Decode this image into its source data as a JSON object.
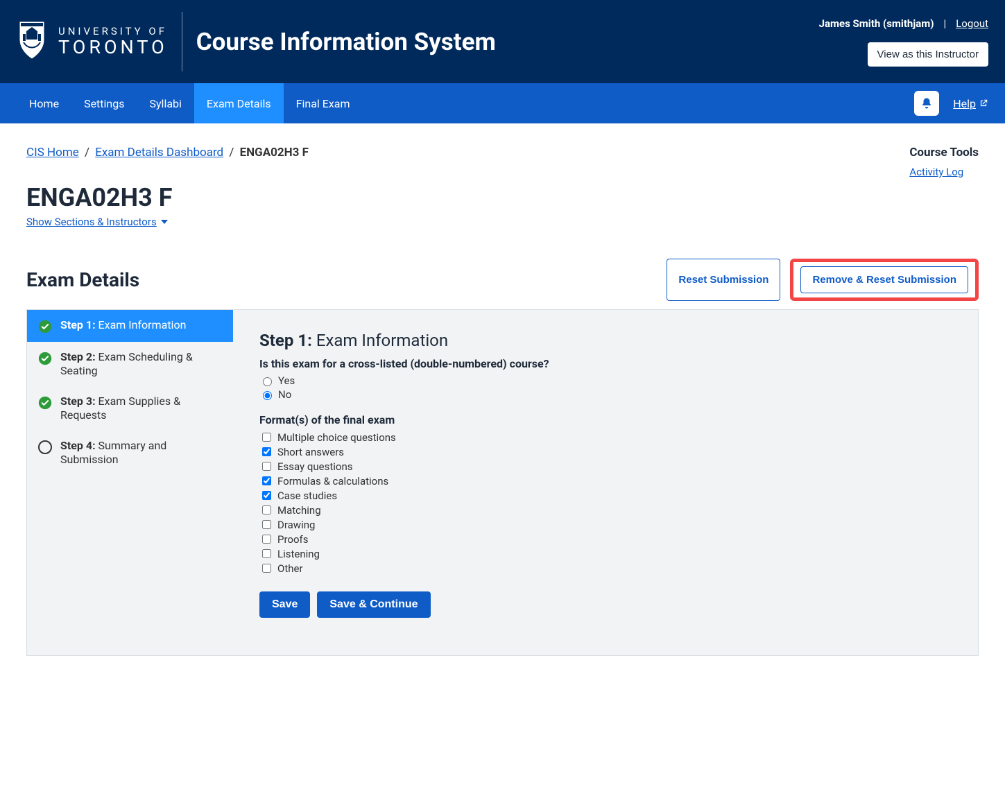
{
  "header": {
    "brand_line1": "UNIVERSITY OF",
    "brand_line2": "TORONTO",
    "app_title": "Course Information System",
    "user_display": "James Smith (smithjam)",
    "logout": "Logout",
    "view_as": "View as this Instructor"
  },
  "nav": {
    "items": [
      "Home",
      "Settings",
      "Syllabi",
      "Exam Details",
      "Final Exam"
    ],
    "active_index": 3,
    "help": "Help"
  },
  "breadcrumb": {
    "home": "CIS Home",
    "dash": "Exam Details Dashboard",
    "current": "ENGA02H3 F"
  },
  "course_tools": {
    "title": "Course Tools",
    "activity_log": "Activity Log"
  },
  "page": {
    "title": "ENGA02H3 F",
    "show_sections": "Show Sections & Instructors"
  },
  "exam_details": {
    "heading": "Exam Details",
    "reset": "Reset Submission",
    "remove_reset": "Remove & Reset Submission"
  },
  "steps": [
    {
      "prefix": "Step 1:",
      "label": "Exam Information",
      "complete": true,
      "active": true
    },
    {
      "prefix": "Step 2:",
      "label": "Exam Scheduling & Seating",
      "complete": true,
      "active": false
    },
    {
      "prefix": "Step 3:",
      "label": "Exam Supplies & Requests",
      "complete": true,
      "active": false
    },
    {
      "prefix": "Step 4:",
      "label": "Summary and Submission",
      "complete": false,
      "active": false
    }
  ],
  "step1": {
    "heading_prefix": "Step 1:",
    "heading_text": "Exam Information",
    "q1_label": "Is this exam for a cross-listed (double-numbered) course?",
    "q1_options": [
      {
        "label": "Yes",
        "checked": false
      },
      {
        "label": "No",
        "checked": true
      }
    ],
    "q2_label": "Format(s) of the final exam",
    "q2_options": [
      {
        "label": "Multiple choice questions",
        "checked": false
      },
      {
        "label": "Short answers",
        "checked": true
      },
      {
        "label": "Essay questions",
        "checked": false
      },
      {
        "label": "Formulas & calculations",
        "checked": true
      },
      {
        "label": "Case studies",
        "checked": true
      },
      {
        "label": "Matching",
        "checked": false
      },
      {
        "label": "Drawing",
        "checked": false
      },
      {
        "label": "Proofs",
        "checked": false
      },
      {
        "label": "Listening",
        "checked": false
      },
      {
        "label": "Other",
        "checked": false
      }
    ],
    "save": "Save",
    "save_continue": "Save & Continue"
  }
}
